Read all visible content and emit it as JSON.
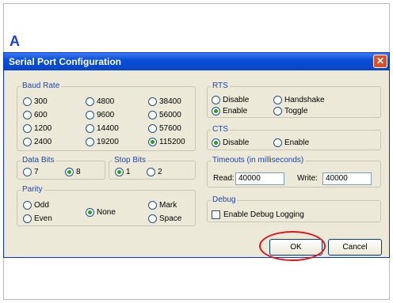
{
  "panel_label": "A",
  "window": {
    "title": "Serial Port Configuration",
    "close_glyph": "✕"
  },
  "baud_rate": {
    "legend": "Baud Rate",
    "options": [
      "300",
      "4800",
      "38400",
      "600",
      "9600",
      "56000",
      "1200",
      "14400",
      "57600",
      "2400",
      "19200",
      "115200"
    ],
    "selected": "115200"
  },
  "data_bits": {
    "legend": "Data Bits",
    "options": [
      "7",
      "8"
    ],
    "selected": "8"
  },
  "stop_bits": {
    "legend": "Stop Bits",
    "options": [
      "1",
      "2"
    ],
    "selected": "1"
  },
  "parity": {
    "legend": "Parity",
    "options": [
      "Odd",
      "Even",
      "None",
      "Mark",
      "Space"
    ],
    "selected": "None"
  },
  "rts": {
    "legend": "RTS",
    "options": [
      "Disable",
      "Handshake",
      "Enable",
      "Toggle"
    ],
    "selected": "Enable"
  },
  "cts": {
    "legend": "CTS",
    "options": [
      "Disable",
      "Enable"
    ],
    "selected": "Disable"
  },
  "timeouts": {
    "legend": "Timeouts (in milliseconds)",
    "read_label": "Read:",
    "read_value": "40000",
    "write_label": "Write:",
    "write_value": "40000"
  },
  "debug": {
    "legend": "Debug",
    "checkbox_label": "Enable Debug Logging",
    "checked": false
  },
  "buttons": {
    "ok": "OK",
    "cancel": "Cancel"
  },
  "colors": {
    "title_bar": "#0a4fd8",
    "legend_text": "#1f46b4",
    "highlight": "#e0141b",
    "dialog_bg": "#ece9d8"
  }
}
